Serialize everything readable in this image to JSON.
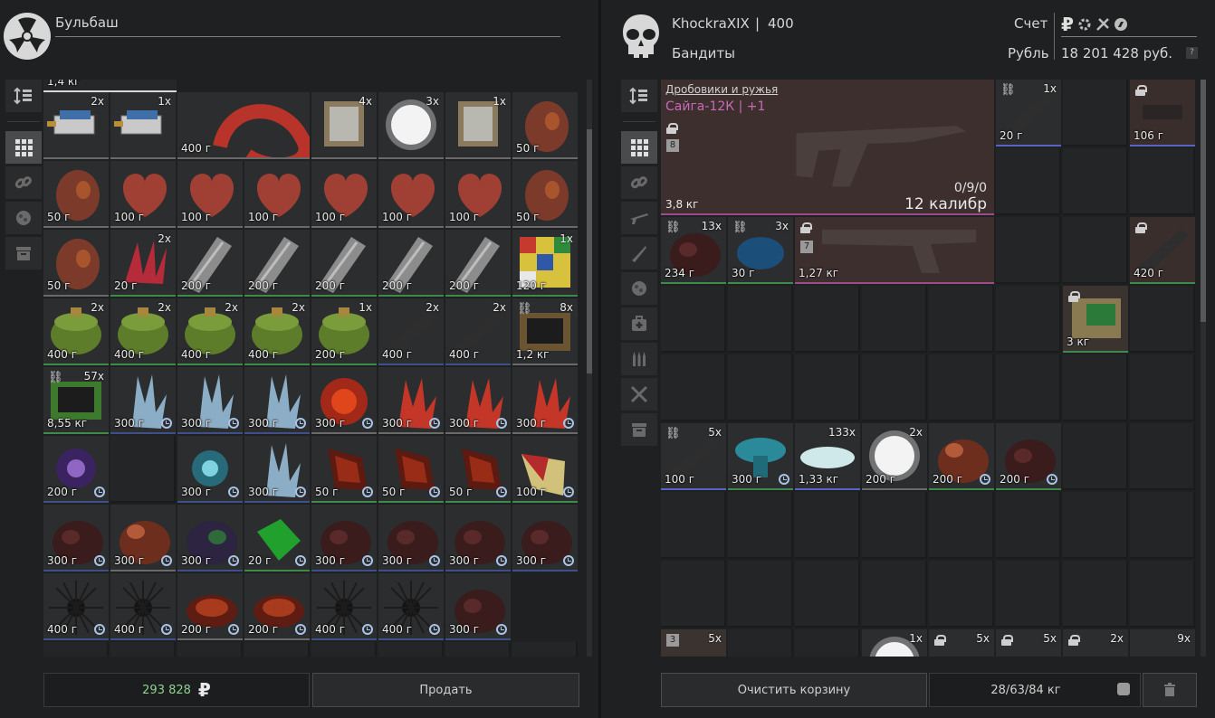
{
  "left": {
    "username": "Бульбаш",
    "money": "293 828",
    "currency_symbol": "₽",
    "sell_label": "Продать",
    "partial_weight": "1,4 кг",
    "items": [
      {
        "weight": "",
        "count": "2x",
        "kind": "battery"
      },
      {
        "weight": "",
        "count": "1x",
        "kind": "battery"
      },
      {
        "weight": "400 г",
        "count": "",
        "kind": "sausage"
      },
      {
        "weight": "",
        "count": "4x",
        "kind": "transformer"
      },
      {
        "weight": "",
        "count": "3x",
        "kind": "fluff"
      },
      {
        "weight": "",
        "count": "1x",
        "kind": "transformer"
      },
      {
        "weight": "50 г",
        "count": "",
        "kind": "heart-organ"
      },
      {
        "weight": "50 г",
        "count": "",
        "kind": "heart-organ"
      },
      {
        "weight": "100 г",
        "count": "",
        "kind": "heart"
      },
      {
        "weight": "100 г",
        "count": "",
        "kind": "heart"
      },
      {
        "weight": "100 г",
        "count": "",
        "kind": "heart"
      },
      {
        "weight": "100 г",
        "count": "",
        "kind": "heart"
      },
      {
        "weight": "100 г",
        "count": "",
        "kind": "heart"
      },
      {
        "weight": "100 г",
        "count": "",
        "kind": "heart"
      },
      {
        "weight": "50 г",
        "count": "",
        "kind": "heart-organ"
      },
      {
        "weight": "50 г",
        "count": "",
        "kind": "heart-organ"
      },
      {
        "weight": "20 г",
        "count": "2x",
        "kind": "spikes"
      },
      {
        "weight": "200 г",
        "count": "",
        "kind": "multitool"
      },
      {
        "weight": "200 г",
        "count": "",
        "kind": "multitool"
      },
      {
        "weight": "200 г",
        "count": "",
        "kind": "multitool"
      },
      {
        "weight": "200 г",
        "count": "",
        "kind": "multitool"
      },
      {
        "weight": "200 г",
        "count": "",
        "kind": "multitool"
      },
      {
        "weight": "120 г",
        "count": "1x",
        "kind": "cube"
      },
      {
        "weight": "400 г",
        "count": "2x",
        "kind": "can"
      },
      {
        "weight": "400 г",
        "count": "2x",
        "kind": "can"
      },
      {
        "weight": "400 г",
        "count": "2x",
        "kind": "can"
      },
      {
        "weight": "400 г",
        "count": "2x",
        "kind": "can"
      },
      {
        "weight": "200 г",
        "count": "1x",
        "kind": "can"
      },
      {
        "weight": "400 г",
        "count": "2x",
        "kind": "rail"
      },
      {
        "weight": "400 г",
        "count": "2x",
        "kind": "rail"
      },
      {
        "weight": "1,2 кг",
        "count": "8x",
        "kind": "pda",
        "link": true
      },
      {
        "weight": "8,55 кг",
        "count": "57x",
        "kind": "pda-green",
        "link": true
      },
      {
        "weight": "300 г",
        "count": "",
        "kind": "crystal",
        "clock": true
      },
      {
        "weight": "300 г",
        "count": "",
        "kind": "crystal",
        "clock": true
      },
      {
        "weight": "300 г",
        "count": "",
        "kind": "crystal",
        "clock": true
      },
      {
        "weight": "300 г",
        "count": "",
        "kind": "flower-red",
        "clock": true
      },
      {
        "weight": "300 г",
        "count": "",
        "kind": "red-crystal",
        "clock": true
      },
      {
        "weight": "300 г",
        "count": "",
        "kind": "red-crystal",
        "clock": true
      },
      {
        "weight": "300 г",
        "count": "",
        "kind": "red-crystal",
        "clock": true
      },
      {
        "weight": "200 г",
        "count": "",
        "kind": "burst",
        "clock": true
      },
      {
        "weight": "",
        "count": "",
        "kind": "empty"
      },
      {
        "weight": "300 г",
        "count": "",
        "kind": "blue-burst",
        "clock": true
      },
      {
        "weight": "300 г",
        "count": "",
        "kind": "crystal",
        "clock": true
      },
      {
        "weight": "50 г",
        "count": "",
        "kind": "lava",
        "clock": true
      },
      {
        "weight": "50 г",
        "count": "",
        "kind": "lava",
        "clock": true
      },
      {
        "weight": "50 г",
        "count": "",
        "kind": "lava",
        "clock": true
      },
      {
        "weight": "100 г",
        "count": "",
        "kind": "shard",
        "clock": true
      },
      {
        "weight": "300 г",
        "count": "",
        "kind": "rock-dark",
        "clock": true
      },
      {
        "weight": "300 г",
        "count": "",
        "kind": "rock-red",
        "clock": true
      },
      {
        "weight": "300 г",
        "count": "",
        "kind": "rock-purple",
        "clock": true
      },
      {
        "weight": "20 г",
        "count": "",
        "kind": "green-rock",
        "clock": true
      },
      {
        "weight": "300 г",
        "count": "",
        "kind": "rock-dark",
        "clock": true
      },
      {
        "weight": "300 г",
        "count": "",
        "kind": "rock-dark",
        "clock": true
      },
      {
        "weight": "300 г",
        "count": "",
        "kind": "rock-dark",
        "clock": true
      },
      {
        "weight": "300 г",
        "count": "",
        "kind": "rock-dark",
        "clock": true
      },
      {
        "weight": "400 г",
        "count": "",
        "kind": "urchin",
        "clock": true
      },
      {
        "weight": "400 г",
        "count": "",
        "kind": "urchin",
        "clock": true
      },
      {
        "weight": "200 г",
        "count": "",
        "kind": "ember",
        "clock": true
      },
      {
        "weight": "200 г",
        "count": "",
        "kind": "ember",
        "clock": true
      },
      {
        "weight": "400 г",
        "count": "",
        "kind": "urchin",
        "clock": true
      },
      {
        "weight": "400 г",
        "count": "",
        "kind": "urchin",
        "clock": true
      },
      {
        "weight": "300 г",
        "count": "",
        "kind": "rock-dark",
        "clock": true
      }
    ],
    "nav_icons": [
      "sort-icon",
      "grid-icon",
      "link-icon",
      "artifact-icon",
      "archive-icon"
    ]
  },
  "right": {
    "trader_name": "KhockraXIX",
    "separator": "|",
    "trader_level": "400",
    "faction": "Бандиты",
    "account_label": "Счет",
    "currency_label": "Рубль",
    "balance": "18 201 428 руб.",
    "help_badge": "?",
    "clear_cart_label": "Очистить корзину",
    "weight_capacity": "28/63/84 кг",
    "weapon": {
      "category": "Дробовики и ружья",
      "name": "Сайга-12К | +1",
      "level_badge": "8",
      "ammo": "0/9/0",
      "caliber": "12 калибр",
      "weight": "3,8 кг"
    },
    "pistol": {
      "level_badge": "7",
      "weight": "1,27 кг"
    },
    "items": [
      {
        "id": "syringe-top",
        "weight": "20 г",
        "count": "1x",
        "link": true
      },
      {
        "id": "muzzle",
        "weight": "106 г",
        "lock": true
      },
      {
        "id": "mushroom",
        "weight": "234 г",
        "count": "13x",
        "link": true
      },
      {
        "id": "blue-moss",
        "weight": "30 г",
        "count": "3x",
        "link": true
      },
      {
        "id": "scope",
        "weight": "420 г",
        "lock": true
      },
      {
        "id": "detector",
        "weight": "3 кг",
        "lock": true
      },
      {
        "id": "syringe-2",
        "weight": "100 г",
        "count": "5x",
        "link": true
      },
      {
        "id": "blue-mushroom",
        "weight": "300 г",
        "clock": true
      },
      {
        "id": "salt",
        "weight": "1,33 кг",
        "count": "133x"
      },
      {
        "id": "fluff-2",
        "weight": "200 г",
        "count": "2x"
      },
      {
        "id": "bone-mutant",
        "weight": "200 г",
        "clock": true
      },
      {
        "id": "red-mutant",
        "weight": "200 г",
        "clock": true
      },
      {
        "id": "box-bottom",
        "level_badge": "3",
        "count": "5x"
      },
      {
        "id": "fluff-bottom",
        "count": "1x"
      },
      {
        "id": "ammo-1",
        "count": "5x",
        "lock": true
      },
      {
        "id": "ammo-2",
        "count": "5x",
        "lock": true
      },
      {
        "id": "ammo-3",
        "count": "2x",
        "lock": true
      },
      {
        "id": "ammo-4",
        "count": "9x"
      }
    ],
    "nav_icons": [
      "sort-icon",
      "grid-icon",
      "link-icon",
      "rifle-icon",
      "knife-icon",
      "artifact-icon",
      "medkit-icon",
      "ammo-icon",
      "tools-icon",
      "archive-icon"
    ]
  }
}
